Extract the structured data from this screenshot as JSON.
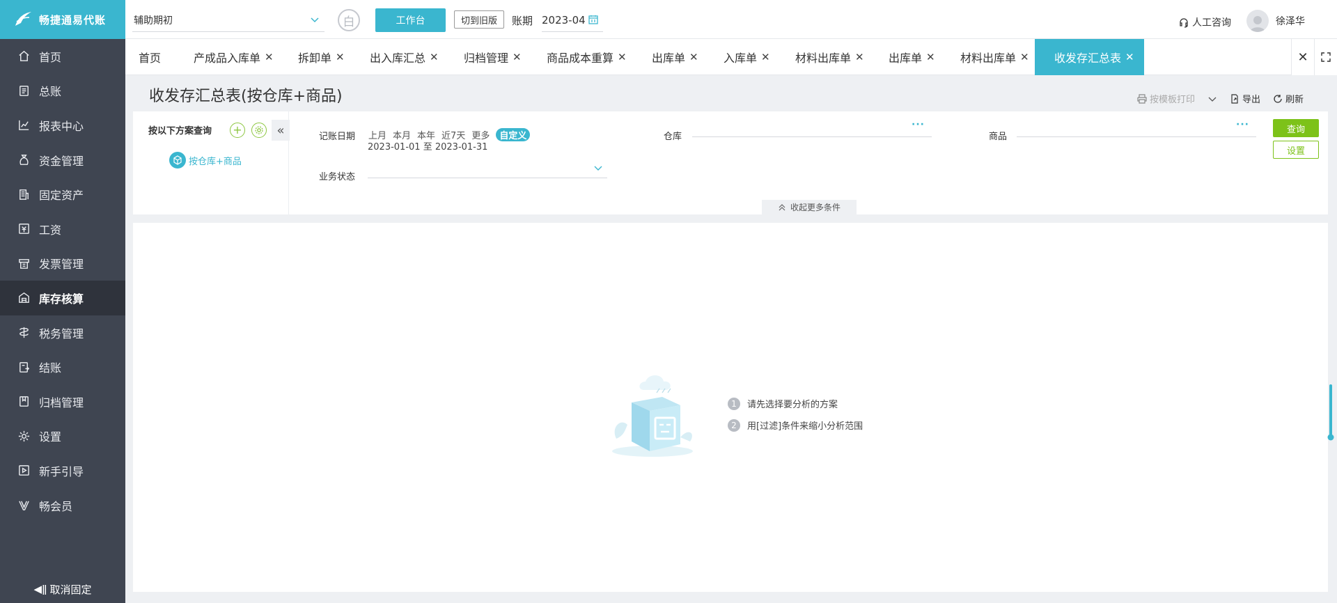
{
  "app": {
    "logo_text": "畅捷通易代账",
    "colors": {
      "brand": "#3ab6cf",
      "sidebar_bg": "#3f4551",
      "sidebar_active": "#2f333c",
      "green": "#7dc219"
    }
  },
  "sidebar": {
    "items": [
      {
        "label": "首页",
        "icon": "home-icon"
      },
      {
        "label": "总账",
        "icon": "ledger-icon"
      },
      {
        "label": "报表中心",
        "icon": "chart-icon"
      },
      {
        "label": "资金管理",
        "icon": "money-bag-icon"
      },
      {
        "label": "固定资产",
        "icon": "building-icon"
      },
      {
        "label": "工资",
        "icon": "salary-icon"
      },
      {
        "label": "发票管理",
        "icon": "invoice-icon"
      },
      {
        "label": "库存核算",
        "icon": "warehouse-icon",
        "active": true
      },
      {
        "label": "税务管理",
        "icon": "tax-icon"
      },
      {
        "label": "结账",
        "icon": "checkout-icon"
      },
      {
        "label": "归档管理",
        "icon": "archive-icon"
      },
      {
        "label": "设置",
        "icon": "gear-icon"
      },
      {
        "label": "新手引导",
        "icon": "guide-icon"
      },
      {
        "label": "畅会员",
        "icon": "vip-icon"
      }
    ],
    "unpin_label": "取消固定"
  },
  "topbar": {
    "book_select": "辅助期初",
    "circle_btn": "白",
    "workbench_label": "工作台",
    "old_version_label": "切到旧版",
    "period_label": "账期",
    "period_value": "2023-04",
    "support_label": "人工咨询",
    "user_name": "徐泽华"
  },
  "tabs": [
    {
      "label": "首页",
      "closable": false
    },
    {
      "label": "产成品入库单",
      "closable": true
    },
    {
      "label": "拆卸单",
      "closable": true
    },
    {
      "label": "出入库汇总",
      "closable": true
    },
    {
      "label": "归档管理",
      "closable": true
    },
    {
      "label": "商品成本重算",
      "closable": true
    },
    {
      "label": "出库单",
      "closable": true
    },
    {
      "label": "入库单",
      "closable": true
    },
    {
      "label": "材料出库单",
      "closable": true
    },
    {
      "label": "出库单",
      "closable": true
    },
    {
      "label": "材料出库单",
      "closable": true
    },
    {
      "label": "收发存汇总表",
      "closable": true,
      "active": true
    }
  ],
  "page": {
    "title": "收发存汇总表(按仓库+商品)",
    "actions": {
      "print": "按模板打印",
      "export": "导出",
      "refresh": "刷新"
    }
  },
  "filter": {
    "scheme_title": "按以下方案查询",
    "scheme_item": "按仓库+商品",
    "date_label": "记账日期",
    "quick_ranges": [
      "上月",
      "本月",
      "本年",
      "近7天",
      "更多",
      "自定义"
    ],
    "quick_active": "自定义",
    "date_start": "2023-01-01",
    "date_sep": "至",
    "date_end": "2023-01-31",
    "warehouse_label": "仓库",
    "warehouse_value": "",
    "goods_label": "商品",
    "goods_value": "",
    "status_label": "业务状态",
    "status_value": "",
    "query_label": "查询",
    "settings_label": "设置",
    "collapse_label": "收起更多条件",
    "more_dots": "···"
  },
  "empty_state": {
    "steps": [
      "请先选择要分析的方案",
      "用[过滤]条件来缩小分析范围"
    ]
  }
}
